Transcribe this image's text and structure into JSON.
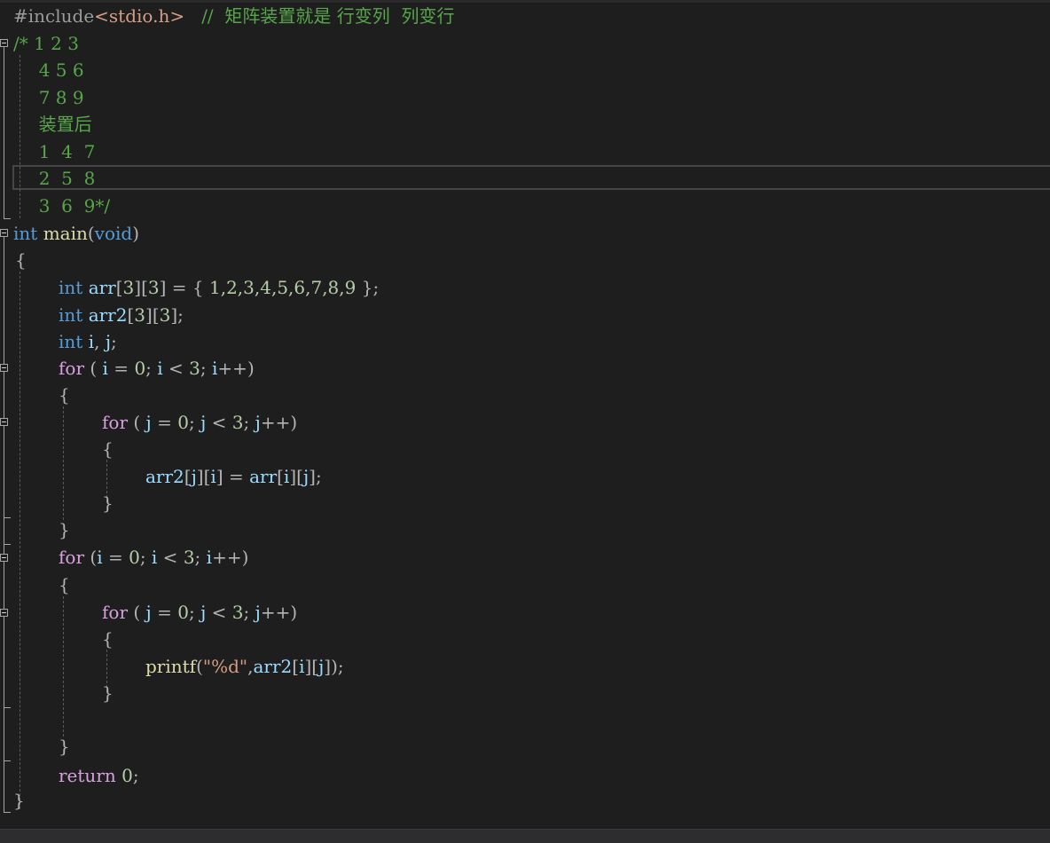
{
  "code": {
    "include_directive": "#include",
    "include_header": "<stdio.h>",
    "include_comment": "//  矩阵装置就是 行变列  列变行",
    "block_comment": [
      "/* 1 2 3",
      "  4 5 6",
      "  7 8 9",
      "  装置后",
      "  1  4  7",
      "  2  5  8",
      "  3  6  9*/"
    ],
    "kw_int": "int",
    "kw_void": "void",
    "kw_for": "for",
    "kw_return": "return",
    "fn_main": "main",
    "fn_printf": "printf",
    "var_arr": "arr",
    "var_arr2": "arr2",
    "var_i": "i",
    "var_j": "j",
    "arr_init_values": "1,2,3,4,5,6,7,8,9",
    "dim": "3",
    "zero": "0",
    "format_string": "\"%d\""
  }
}
